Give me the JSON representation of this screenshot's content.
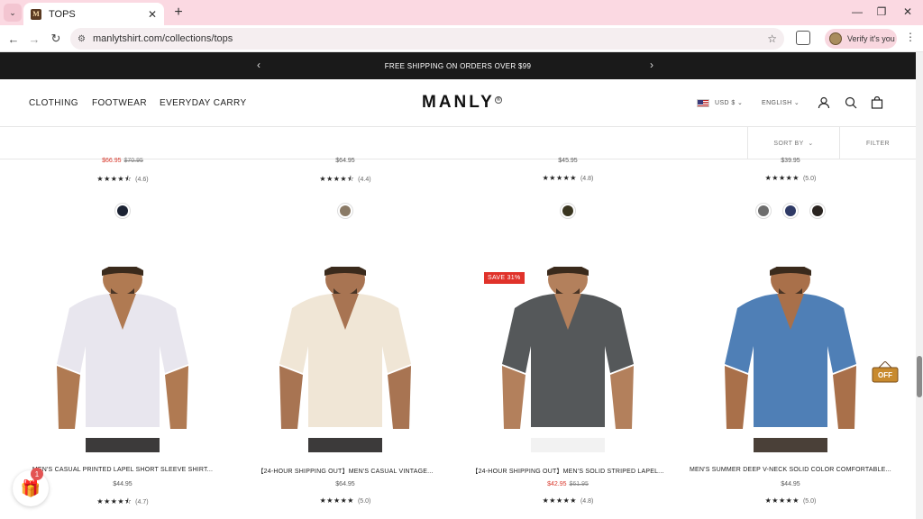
{
  "browser": {
    "tab_title": "TOPS",
    "url": "manlytshirt.com/collections/tops",
    "verify_label": "Verify it's you",
    "icons": {
      "tab_menu": "chevron-down-icon",
      "tab_close": "close-icon",
      "new_tab": "plus-icon",
      "minimize": "minimize-icon",
      "restore": "restore-icon",
      "window_close": "close-icon",
      "back": "arrow-left-icon",
      "forward": "arrow-right-icon",
      "reload": "reload-icon",
      "site_info": "tune-icon",
      "bookmark": "star-icon",
      "extensions": "puzzle-icon",
      "menu": "kebab-icon"
    },
    "glyphs": {
      "tab_menu": "⌄",
      "tab_close": "✕",
      "new_tab": "+",
      "minimize": "—",
      "restore": "❐",
      "window_close": "✕",
      "back": "←",
      "forward": "→",
      "reload": "↻",
      "site_info": "⚙",
      "bookmark": "☆",
      "menu": "⋮"
    }
  },
  "announcement": {
    "text": "FREE SHIPPING ON ORDERS OVER $99",
    "prev": "‹",
    "next": "›"
  },
  "header": {
    "nav": [
      "CLOTHING",
      "FOOTWEAR",
      "EVERYDAY CARRY"
    ],
    "logo": "MANLY",
    "logo_mark": "®",
    "currency": "USD $",
    "language": "ENGLISH",
    "caret": "⌄",
    "icons": {
      "account": "user-icon",
      "search": "search-icon",
      "cart": "bag-icon"
    },
    "glyphs": {
      "account": "👤",
      "search": "⌕",
      "cart": "👜"
    }
  },
  "filterbar": {
    "sort_label": "SORT BY",
    "filter_label": "FILTER"
  },
  "colors": {
    "sale_red": "#d9382b",
    "badge_red": "#e0322a",
    "announcement_bg": "#1a1a1a",
    "tab_strip": "#fbd9e2"
  },
  "row1": [
    {
      "price": "$66.95",
      "compare": "$70.95",
      "on_sale": true,
      "stars": "★★★★⯪",
      "rating": "(4.6)",
      "swatches": [
        "#1b2233"
      ]
    },
    {
      "price": "$64.95",
      "compare": "",
      "on_sale": false,
      "stars": "★★★★⯪",
      "rating": "(4.4)",
      "swatches": [
        "#8a7a66"
      ]
    },
    {
      "price": "$45.95",
      "compare": "",
      "on_sale": false,
      "stars": "★★★★★",
      "rating": "(4.8)",
      "swatches": [
        "#3a3520"
      ]
    },
    {
      "price": "$39.95",
      "compare": "",
      "on_sale": false,
      "stars": "★★★★★",
      "rating": "(5.0)",
      "swatches": [
        "#6d6d6d",
        "#2f3a66",
        "#2a2420"
      ]
    }
  ],
  "row2": [
    {
      "title": "MEN'S CASUAL PRINTED LAPEL SHORT SLEEVE SHIRT...",
      "price": "$44.95",
      "compare": "",
      "on_sale": false,
      "badge": "",
      "stars": "★★★★⯪",
      "rating": "(4.7)",
      "shirt_color": "#e8e6ee",
      "skin": "#b07a52"
    },
    {
      "title": "【24-HOUR SHIPPING OUT】MEN'S CASUAL VINTAGE...",
      "price": "$64.95",
      "compare": "",
      "on_sale": false,
      "badge": "",
      "stars": "★★★★★",
      "rating": "(5.0)",
      "shirt_color": "#f0e6d6",
      "skin": "#a87452"
    },
    {
      "title": "【24-HOUR SHIPPING OUT】MEN'S SOLID STRIPED LAPEL...",
      "price": "$42.95",
      "compare": "$61.95",
      "on_sale": true,
      "badge": "SAVE 31%",
      "stars": "★★★★★",
      "rating": "(4.8)",
      "shirt_color": "#55585a",
      "skin": "#b3805c"
    },
    {
      "title": "MEN'S SUMMER DEEP V-NECK SOLID COLOR COMFORTABLE...",
      "price": "$44.95",
      "compare": "",
      "on_sale": false,
      "badge": "",
      "stars": "★★★★★",
      "rating": "(5.0)",
      "shirt_color": "#4f7fb6",
      "skin": "#a9704a"
    }
  ],
  "floating": {
    "gift_icon": "gift-icon",
    "gift_glyph": "🎁",
    "gift_count": "1",
    "promo_icon": "off-sign-icon",
    "promo_text": "OFF"
  }
}
